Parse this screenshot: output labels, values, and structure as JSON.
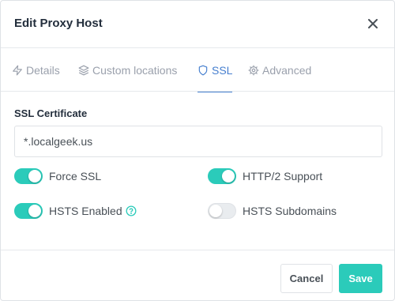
{
  "modal": {
    "title": "Edit Proxy Host"
  },
  "tabs": [
    {
      "label": "Details",
      "icon": "lightning-icon",
      "active": false
    },
    {
      "label": "Custom locations",
      "icon": "layers-icon",
      "active": false
    },
    {
      "label": "SSL",
      "icon": "shield-icon",
      "active": true
    },
    {
      "label": "Advanced",
      "icon": "gear-icon",
      "active": false
    }
  ],
  "ssl": {
    "certificate_label": "SSL Certificate",
    "certificate_value": "*.localgeek.us",
    "toggles": [
      {
        "label": "Force SSL",
        "on": true
      },
      {
        "label": "HTTP/2 Support",
        "on": true
      },
      {
        "label": "HSTS Enabled",
        "on": true
      },
      {
        "label": "HSTS Subdomains",
        "on": false
      }
    ]
  },
  "footer": {
    "cancel_label": "Cancel",
    "save_label": "Save"
  },
  "colors": {
    "accent": "#2bcbba",
    "tab_active": "#467fcf",
    "help_icon": "#2bcbba"
  }
}
